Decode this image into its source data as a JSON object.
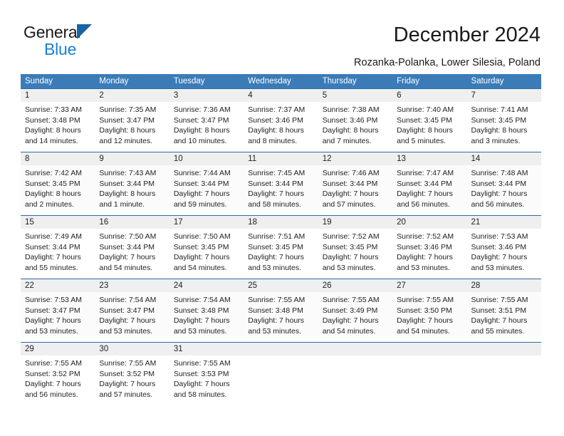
{
  "logo": {
    "word1": "General",
    "word2": "Blue",
    "triangle_color": "#1565a8",
    "blue_color": "#1b7fd4",
    "icon": "triangle-icon"
  },
  "header": {
    "month_title": "December 2024",
    "location": "Rozanka-Polanka, Lower Silesia, Poland"
  },
  "colors": {
    "header_bar": "#3b7cb8",
    "day_band": "#efefef",
    "row_rule": "#2a6ca8",
    "text": "#222222"
  },
  "calendar": {
    "weekday_headers": [
      "Sunday",
      "Monday",
      "Tuesday",
      "Wednesday",
      "Thursday",
      "Friday",
      "Saturday"
    ],
    "weeks": [
      [
        {
          "day": "1",
          "sunrise": "Sunrise: 7:33 AM",
          "sunset": "Sunset: 3:48 PM",
          "daylight1": "Daylight: 8 hours",
          "daylight2": "and 14 minutes."
        },
        {
          "day": "2",
          "sunrise": "Sunrise: 7:35 AM",
          "sunset": "Sunset: 3:47 PM",
          "daylight1": "Daylight: 8 hours",
          "daylight2": "and 12 minutes."
        },
        {
          "day": "3",
          "sunrise": "Sunrise: 7:36 AM",
          "sunset": "Sunset: 3:47 PM",
          "daylight1": "Daylight: 8 hours",
          "daylight2": "and 10 minutes."
        },
        {
          "day": "4",
          "sunrise": "Sunrise: 7:37 AM",
          "sunset": "Sunset: 3:46 PM",
          "daylight1": "Daylight: 8 hours",
          "daylight2": "and 8 minutes."
        },
        {
          "day": "5",
          "sunrise": "Sunrise: 7:38 AM",
          "sunset": "Sunset: 3:46 PM",
          "daylight1": "Daylight: 8 hours",
          "daylight2": "and 7 minutes."
        },
        {
          "day": "6",
          "sunrise": "Sunrise: 7:40 AM",
          "sunset": "Sunset: 3:45 PM",
          "daylight1": "Daylight: 8 hours",
          "daylight2": "and 5 minutes."
        },
        {
          "day": "7",
          "sunrise": "Sunrise: 7:41 AM",
          "sunset": "Sunset: 3:45 PM",
          "daylight1": "Daylight: 8 hours",
          "daylight2": "and 3 minutes."
        }
      ],
      [
        {
          "day": "8",
          "sunrise": "Sunrise: 7:42 AM",
          "sunset": "Sunset: 3:45 PM",
          "daylight1": "Daylight: 8 hours",
          "daylight2": "and 2 minutes."
        },
        {
          "day": "9",
          "sunrise": "Sunrise: 7:43 AM",
          "sunset": "Sunset: 3:44 PM",
          "daylight1": "Daylight: 8 hours",
          "daylight2": "and 1 minute."
        },
        {
          "day": "10",
          "sunrise": "Sunrise: 7:44 AM",
          "sunset": "Sunset: 3:44 PM",
          "daylight1": "Daylight: 7 hours",
          "daylight2": "and 59 minutes."
        },
        {
          "day": "11",
          "sunrise": "Sunrise: 7:45 AM",
          "sunset": "Sunset: 3:44 PM",
          "daylight1": "Daylight: 7 hours",
          "daylight2": "and 58 minutes."
        },
        {
          "day": "12",
          "sunrise": "Sunrise: 7:46 AM",
          "sunset": "Sunset: 3:44 PM",
          "daylight1": "Daylight: 7 hours",
          "daylight2": "and 57 minutes."
        },
        {
          "day": "13",
          "sunrise": "Sunrise: 7:47 AM",
          "sunset": "Sunset: 3:44 PM",
          "daylight1": "Daylight: 7 hours",
          "daylight2": "and 56 minutes."
        },
        {
          "day": "14",
          "sunrise": "Sunrise: 7:48 AM",
          "sunset": "Sunset: 3:44 PM",
          "daylight1": "Daylight: 7 hours",
          "daylight2": "and 56 minutes."
        }
      ],
      [
        {
          "day": "15",
          "sunrise": "Sunrise: 7:49 AM",
          "sunset": "Sunset: 3:44 PM",
          "daylight1": "Daylight: 7 hours",
          "daylight2": "and 55 minutes."
        },
        {
          "day": "16",
          "sunrise": "Sunrise: 7:50 AM",
          "sunset": "Sunset: 3:44 PM",
          "daylight1": "Daylight: 7 hours",
          "daylight2": "and 54 minutes."
        },
        {
          "day": "17",
          "sunrise": "Sunrise: 7:50 AM",
          "sunset": "Sunset: 3:45 PM",
          "daylight1": "Daylight: 7 hours",
          "daylight2": "and 54 minutes."
        },
        {
          "day": "18",
          "sunrise": "Sunrise: 7:51 AM",
          "sunset": "Sunset: 3:45 PM",
          "daylight1": "Daylight: 7 hours",
          "daylight2": "and 53 minutes."
        },
        {
          "day": "19",
          "sunrise": "Sunrise: 7:52 AM",
          "sunset": "Sunset: 3:45 PM",
          "daylight1": "Daylight: 7 hours",
          "daylight2": "and 53 minutes."
        },
        {
          "day": "20",
          "sunrise": "Sunrise: 7:52 AM",
          "sunset": "Sunset: 3:46 PM",
          "daylight1": "Daylight: 7 hours",
          "daylight2": "and 53 minutes."
        },
        {
          "day": "21",
          "sunrise": "Sunrise: 7:53 AM",
          "sunset": "Sunset: 3:46 PM",
          "daylight1": "Daylight: 7 hours",
          "daylight2": "and 53 minutes."
        }
      ],
      [
        {
          "day": "22",
          "sunrise": "Sunrise: 7:53 AM",
          "sunset": "Sunset: 3:47 PM",
          "daylight1": "Daylight: 7 hours",
          "daylight2": "and 53 minutes."
        },
        {
          "day": "23",
          "sunrise": "Sunrise: 7:54 AM",
          "sunset": "Sunset: 3:47 PM",
          "daylight1": "Daylight: 7 hours",
          "daylight2": "and 53 minutes."
        },
        {
          "day": "24",
          "sunrise": "Sunrise: 7:54 AM",
          "sunset": "Sunset: 3:48 PM",
          "daylight1": "Daylight: 7 hours",
          "daylight2": "and 53 minutes."
        },
        {
          "day": "25",
          "sunrise": "Sunrise: 7:55 AM",
          "sunset": "Sunset: 3:48 PM",
          "daylight1": "Daylight: 7 hours",
          "daylight2": "and 53 minutes."
        },
        {
          "day": "26",
          "sunrise": "Sunrise: 7:55 AM",
          "sunset": "Sunset: 3:49 PM",
          "daylight1": "Daylight: 7 hours",
          "daylight2": "and 54 minutes."
        },
        {
          "day": "27",
          "sunrise": "Sunrise: 7:55 AM",
          "sunset": "Sunset: 3:50 PM",
          "daylight1": "Daylight: 7 hours",
          "daylight2": "and 54 minutes."
        },
        {
          "day": "28",
          "sunrise": "Sunrise: 7:55 AM",
          "sunset": "Sunset: 3:51 PM",
          "daylight1": "Daylight: 7 hours",
          "daylight2": "and 55 minutes."
        }
      ],
      [
        {
          "day": "29",
          "sunrise": "Sunrise: 7:55 AM",
          "sunset": "Sunset: 3:52 PM",
          "daylight1": "Daylight: 7 hours",
          "daylight2": "and 56 minutes."
        },
        {
          "day": "30",
          "sunrise": "Sunrise: 7:55 AM",
          "sunset": "Sunset: 3:52 PM",
          "daylight1": "Daylight: 7 hours",
          "daylight2": "and 57 minutes."
        },
        {
          "day": "31",
          "sunrise": "Sunrise: 7:55 AM",
          "sunset": "Sunset: 3:53 PM",
          "daylight1": "Daylight: 7 hours",
          "daylight2": "and 58 minutes."
        },
        {
          "day": "",
          "sunrise": "",
          "sunset": "",
          "daylight1": "",
          "daylight2": ""
        },
        {
          "day": "",
          "sunrise": "",
          "sunset": "",
          "daylight1": "",
          "daylight2": ""
        },
        {
          "day": "",
          "sunrise": "",
          "sunset": "",
          "daylight1": "",
          "daylight2": ""
        },
        {
          "day": "",
          "sunrise": "",
          "sunset": "",
          "daylight1": "",
          "daylight2": ""
        }
      ]
    ]
  }
}
